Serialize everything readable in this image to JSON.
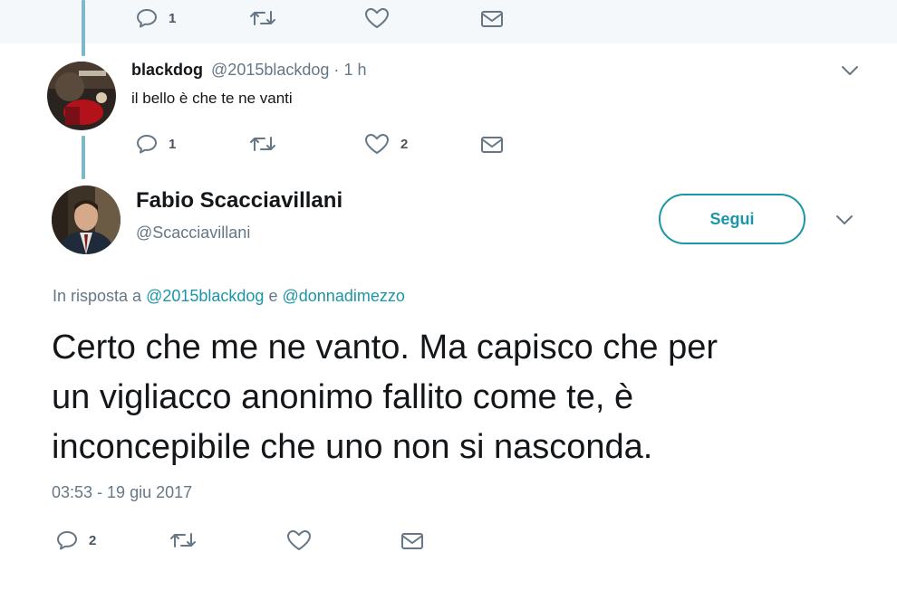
{
  "prev_tweet": {
    "actions": {
      "reply_count": "1",
      "retweet_count": "",
      "like_count": ""
    }
  },
  "reply_tweet": {
    "name": "blackdog",
    "handle": "@2015blackdog",
    "separator": "·",
    "time": "1 h",
    "text": "il bello è che te ne vanti",
    "actions": {
      "reply_count": "1",
      "retweet_count": "",
      "like_count": "2"
    }
  },
  "main_tweet": {
    "name": "Fabio Scacciavillani",
    "handle": "@Scacciavillani",
    "follow_label": "Segui",
    "in_reply_prefix": "In risposta a",
    "in_reply_user1": "@2015blackdog",
    "in_reply_conj": "e",
    "in_reply_user2": "@donnadimezzo",
    "text_line1": "Certo che me ne vanto. Ma capisco che per",
    "text_line2": "un vigliacco anonimo fallito come te, è",
    "text_line3": "inconcepibile che uno non si nasconda.",
    "timestamp": "03:53 - 19 giu 2017",
    "actions": {
      "reply_count": "2",
      "retweet_count": "",
      "like_count": ""
    }
  },
  "colors": {
    "accent": "#1b95a8",
    "thread_line": "#7fb9c9",
    "muted": "#657786",
    "top_background": "#f5f8fa"
  },
  "icons": [
    "reply-icon",
    "retweet-icon",
    "like-icon",
    "message-icon",
    "chevron-down-icon"
  ]
}
